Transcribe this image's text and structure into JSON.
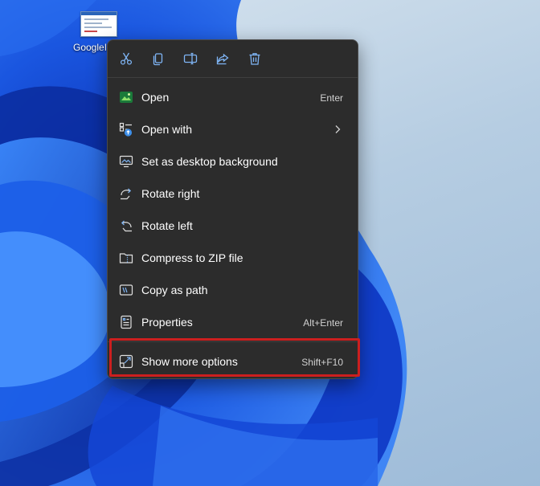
{
  "desktop": {
    "file_icon_name": "image-file-icon",
    "file_label": "GoogleI"
  },
  "context_menu": {
    "toolbar": [
      {
        "name": "cut-icon",
        "label": "Cut"
      },
      {
        "name": "copy-icon",
        "label": "Copy"
      },
      {
        "name": "rename-icon",
        "label": "Rename"
      },
      {
        "name": "share-icon",
        "label": "Share"
      },
      {
        "name": "delete-icon",
        "label": "Delete"
      }
    ],
    "items": [
      {
        "label": "Open",
        "shortcut": "Enter",
        "icon": "image-viewer-icon"
      },
      {
        "label": "Open with",
        "shortcut": "",
        "icon": "open-with-icon",
        "submenu": true
      },
      {
        "label": "Set as desktop background",
        "shortcut": "",
        "icon": "desktop-background-icon"
      },
      {
        "label": "Rotate right",
        "shortcut": "",
        "icon": "rotate-right-icon"
      },
      {
        "label": "Rotate left",
        "shortcut": "",
        "icon": "rotate-left-icon"
      },
      {
        "label": "Compress to ZIP file",
        "shortcut": "",
        "icon": "zip-icon"
      },
      {
        "label": "Copy as path",
        "shortcut": "",
        "icon": "copy-path-icon"
      },
      {
        "label": "Properties",
        "shortcut": "Alt+Enter",
        "icon": "properties-icon"
      },
      {
        "label": "Show more options",
        "shortcut": "Shift+F10",
        "icon": "show-more-icon",
        "highlighted": true
      }
    ]
  },
  "colors": {
    "menu_bg": "#2c2c2c",
    "menu_text": "#ffffff",
    "shortcut_text": "#d0d0d0",
    "highlight_border": "#cc1f1f",
    "accent": "#1f6fd6"
  }
}
